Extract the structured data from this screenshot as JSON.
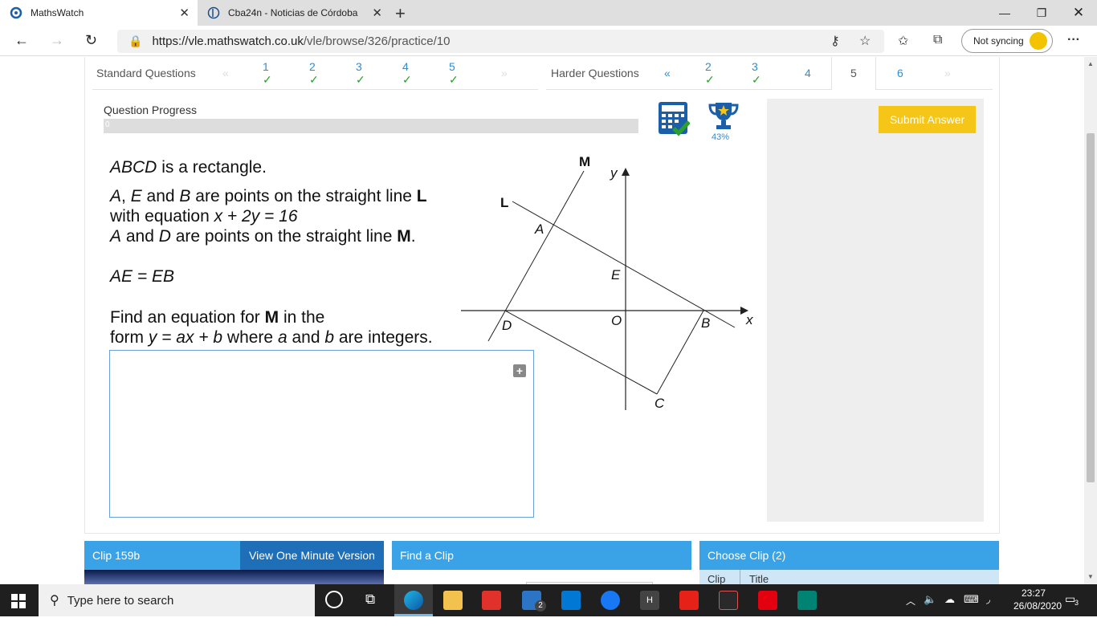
{
  "browser": {
    "tabs": [
      {
        "label": "MathsWatch",
        "active": true
      },
      {
        "label": "Cba24n - Noticias de Córdoba",
        "active": false
      }
    ],
    "url_host": "https://vle.mathswatch.co.uk",
    "url_path": "/vle/browse/326/practice/10",
    "sync_label": "Not syncing"
  },
  "question_nav": {
    "standard_label": "Standard Questions",
    "standard_prev": "«",
    "standard_items": [
      "1",
      "2",
      "3",
      "4",
      "5"
    ],
    "standard_next": "»",
    "harder_label": "Harder Questions",
    "harder_prev": "«",
    "harder_items": [
      "2",
      "3",
      "4",
      "5",
      "6"
    ],
    "harder_next": "»",
    "tick": "✓"
  },
  "progress": {
    "label": "Question Progress",
    "value": "0"
  },
  "trophy_pct": "43%",
  "submit_label": "Submit Answer",
  "question": {
    "line1": "is a rectangle.",
    "line1_var": "ABCD",
    "line2_a": "A",
    "line2_e": "E",
    "line2_b": "B",
    "line2_text1": ", ",
    "line2_text2": " and ",
    "line2_text3": " are points on the straight line ",
    "line2_L": "L",
    "line3": "with equation ",
    "line3_eq": "x + 2y = 16",
    "line4_a": "A",
    "line4_d": "D",
    "line4_text1": " and ",
    "line4_text2": " are points on the straight line ",
    "line4_M": "M",
    "line5": "AE = EB",
    "line6_text1": "Find an equation for ",
    "line6_M": "M",
    "line6_text2": " in the",
    "line7_text1": "form ",
    "line7_eq": "y = ax + b",
    "line7_text2": " where ",
    "line7_a": "a",
    "line7_text3": " and ",
    "line7_b": "b",
    "line7_text4": " are integers."
  },
  "diagram_labels": {
    "M": "M",
    "L": "L",
    "y": "y",
    "x": "x",
    "A": "A",
    "E": "E",
    "O": "O",
    "D": "D",
    "B": "B",
    "C": "C"
  },
  "panels": {
    "clip_label": "Clip 159b",
    "one_min_label": "View One Minute Version",
    "find_clip_label": "Find a Clip",
    "choose_clip_label": "Choose Clip (2)",
    "col_clip": "Clip",
    "col_title": "Title"
  },
  "taskbar": {
    "search_placeholder": "Type here to search",
    "time": "23:27",
    "date": "26/08/2020",
    "notif_count": "3",
    "mail_count": "2"
  }
}
